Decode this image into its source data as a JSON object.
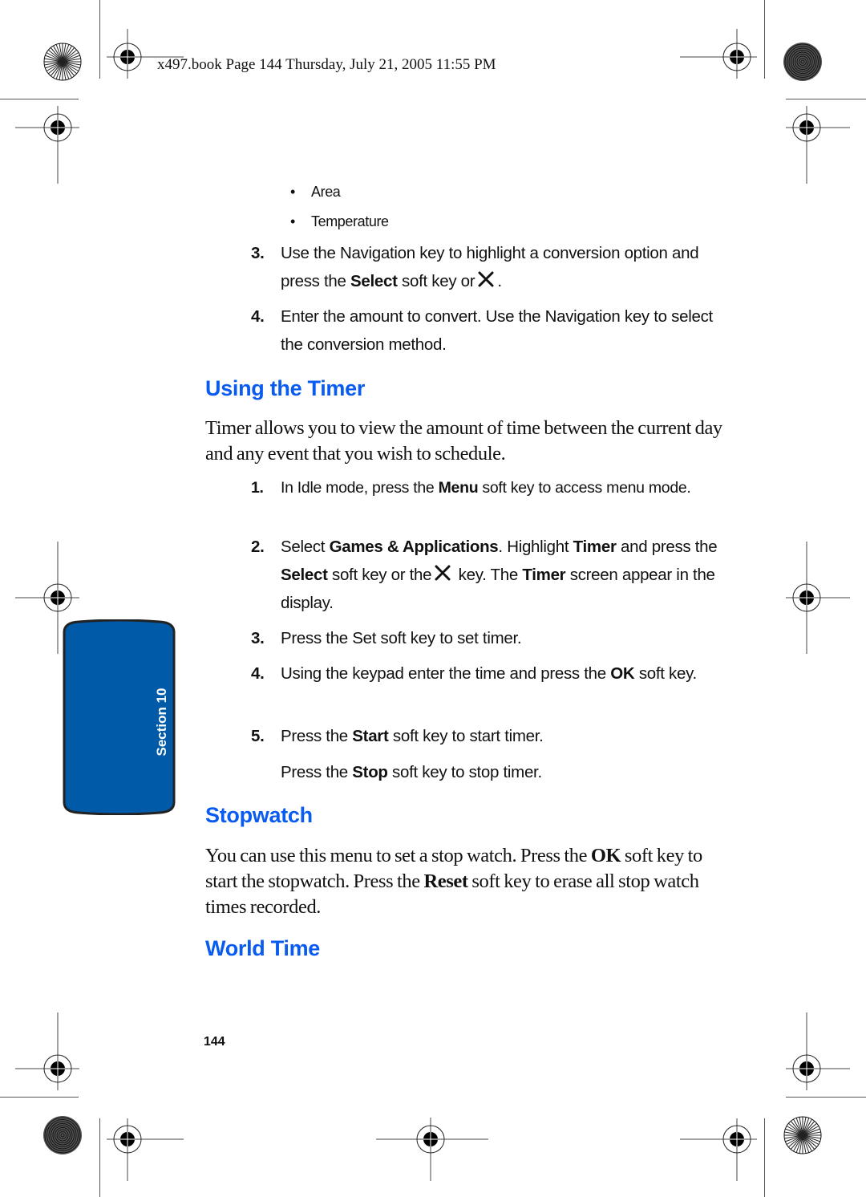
{
  "header": {
    "print_slug": "x497.book  Page 144  Thursday, July 21, 2005  11:55 PM"
  },
  "bullets": [
    {
      "text": "Area"
    },
    {
      "text": "Temperature"
    }
  ],
  "conversion_steps": [
    {
      "num": "3.",
      "pre": "Use the Navigation key to highlight a conversion option and press the ",
      "bold": "Select",
      "post": " soft key or",
      "icon": "navigation-select-key-icon",
      "end": "."
    },
    {
      "num": "4.",
      "text": "Enter the amount to convert. Use the Navigation key to select the conversion method."
    }
  ],
  "sections": {
    "timer": {
      "heading": "Using the Timer",
      "intro": "Timer allows you to view the amount of time between the current day and any event that you wish to schedule.",
      "steps": [
        {
          "num": "1.",
          "parts": [
            "In Idle mode, press the ",
            "Menu",
            " soft key to access menu mode."
          ]
        },
        {
          "num": "2.",
          "parts": [
            "Select ",
            "Games & Applications",
            ". Highlight ",
            "Timer",
            " and press the ",
            "Select",
            " soft key or the",
            " key. The ",
            "Timer",
            " screen appear in the display."
          ]
        },
        {
          "num": "3.",
          "text": "Press the Set soft key to set timer."
        },
        {
          "num": "4.",
          "parts": [
            "Using the keypad enter the time and press the ",
            "OK",
            " soft key."
          ]
        },
        {
          "num": "5.",
          "parts": [
            "Press the ",
            "Start",
            " soft key to start timer."
          ]
        },
        {
          "num": "",
          "parts": [
            "Press the ",
            "Stop",
            " soft key to stop timer."
          ]
        }
      ]
    },
    "stopwatch": {
      "heading": "Stopwatch",
      "parts": [
        "You can use this menu to set a stop watch. Press the ",
        "OK",
        " soft key to start the stopwatch. Press the ",
        "Reset",
        " soft key to erase all stop watch times recorded."
      ]
    },
    "world_time": {
      "heading": "World Time"
    }
  },
  "side_tab": {
    "label": "Section 10",
    "color": "#005aa8",
    "border_color": "#222222"
  },
  "footer": {
    "page_number": "144"
  },
  "colors": {
    "heading": "#0a5cf0",
    "text": "#111111"
  }
}
